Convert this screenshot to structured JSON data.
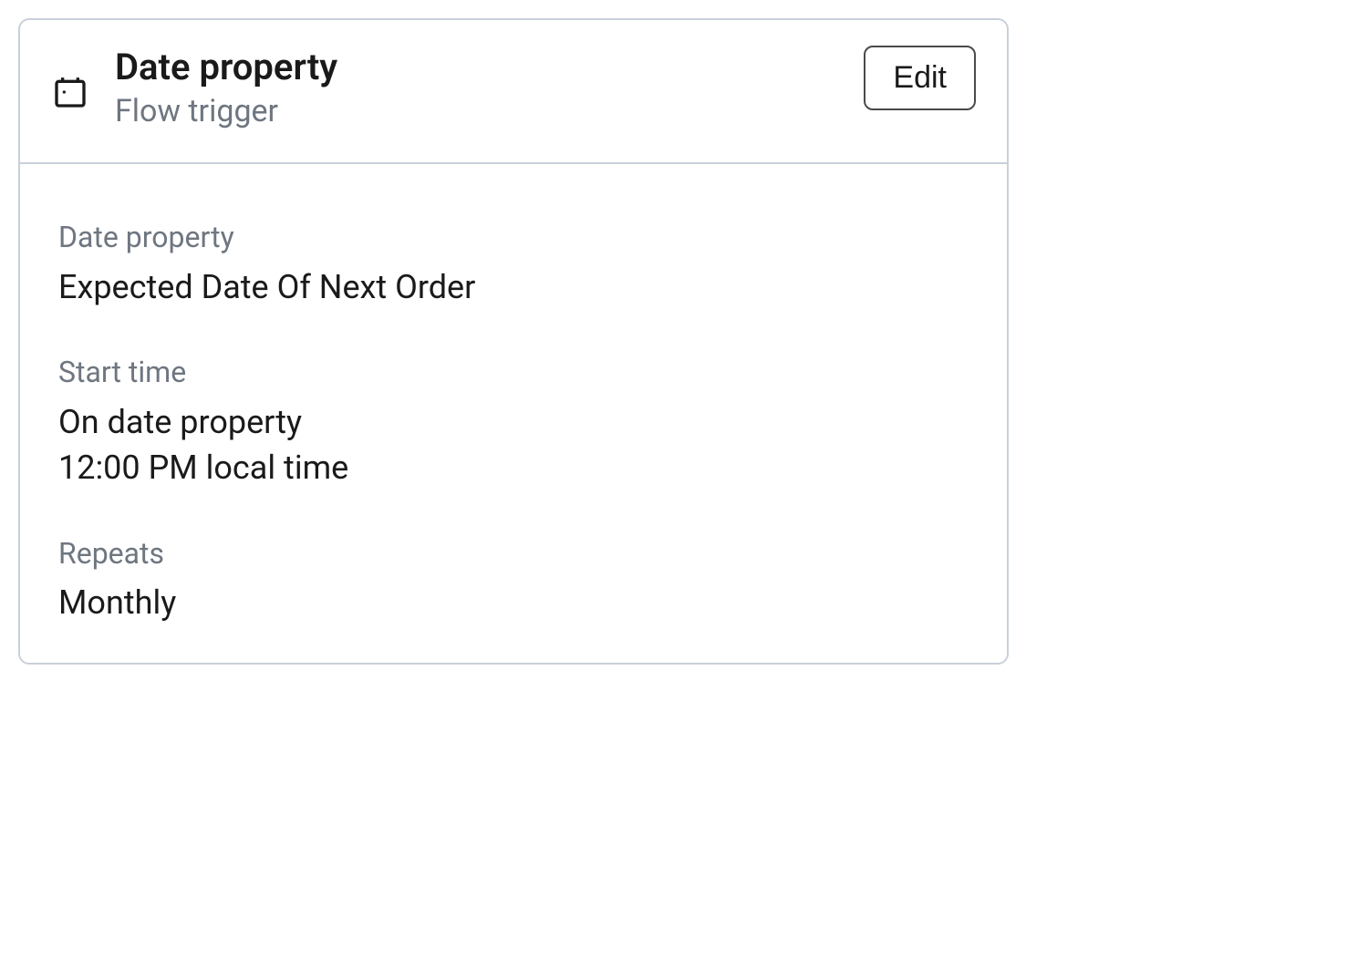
{
  "header": {
    "title": "Date property",
    "subtitle": "Flow trigger",
    "edit_label": "Edit"
  },
  "fields": {
    "date_property": {
      "label": "Date property",
      "value": "Expected Date Of Next Order"
    },
    "start_time": {
      "label": "Start time",
      "value_line1": "On date property",
      "value_line2": "12:00 PM local time"
    },
    "repeats": {
      "label": "Repeats",
      "value": "Monthly"
    }
  }
}
